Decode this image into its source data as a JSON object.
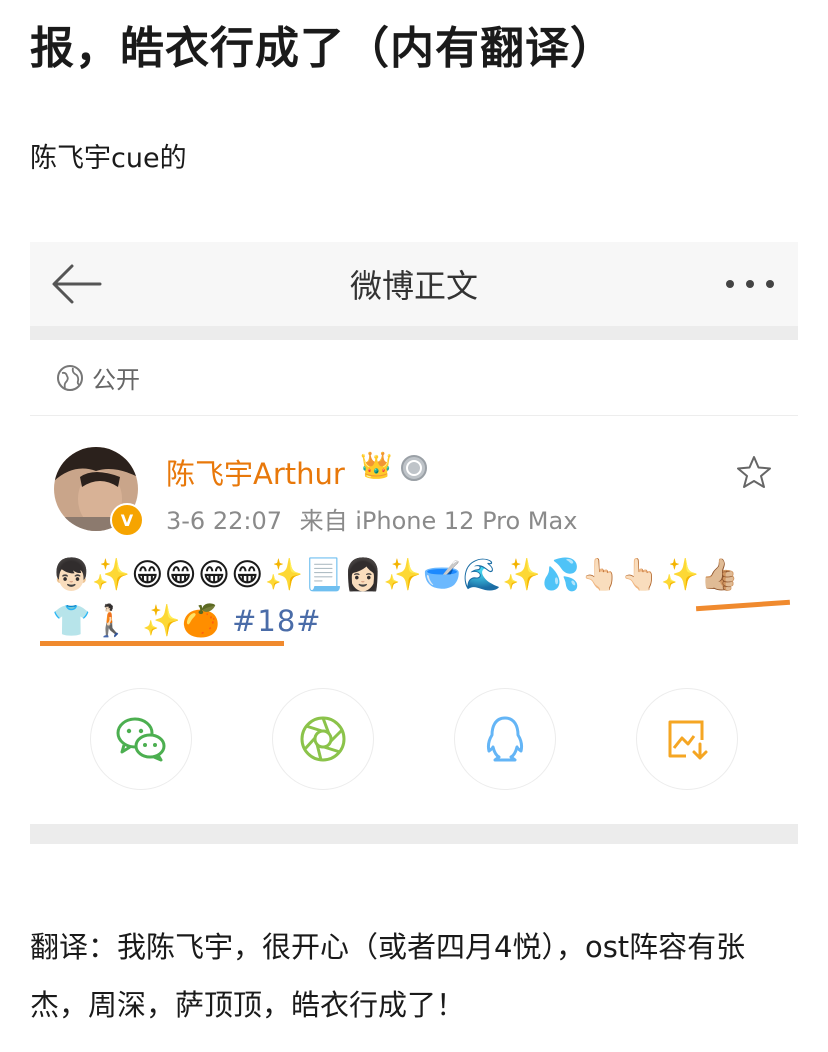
{
  "post": {
    "title": "报，皓衣行成了（内有翻译）",
    "intro": "陈飞宇cue的",
    "translation": "翻译：我陈飞宇，很开心（或者四月4悦），ost阵容有张杰，周深，萨顶顶，皓衣行成了！"
  },
  "weibo": {
    "nav_title": "微博正文",
    "visibility": "公开",
    "author": "陈飞宇Arthur",
    "time": "3-6 22:07",
    "source": "来自 iPhone 12 Pro Max",
    "emoji_line1": "👦🏻✨😁😁😁😁✨📃👩🏻✨🥣🌊✨💦👆🏻👆🏻✨👍🏼",
    "emoji_line2": "👕🚶🏻 ✨🍊",
    "hashtag": "#18#",
    "badge_letter": "V"
  },
  "colors": {
    "author": "#e8780a",
    "hashtag": "#4a6ca8",
    "highlight": "#f08a2e",
    "wechat": "#4caf50",
    "moments": "#8bc34a",
    "qq": "#64b5f6",
    "save": "#f5a623"
  },
  "icons": [
    "back-arrow-icon",
    "more-icon",
    "globe-icon",
    "crown-icon",
    "medal-icon",
    "star-icon",
    "wechat-icon",
    "moments-icon",
    "qq-icon",
    "save-image-icon"
  ]
}
